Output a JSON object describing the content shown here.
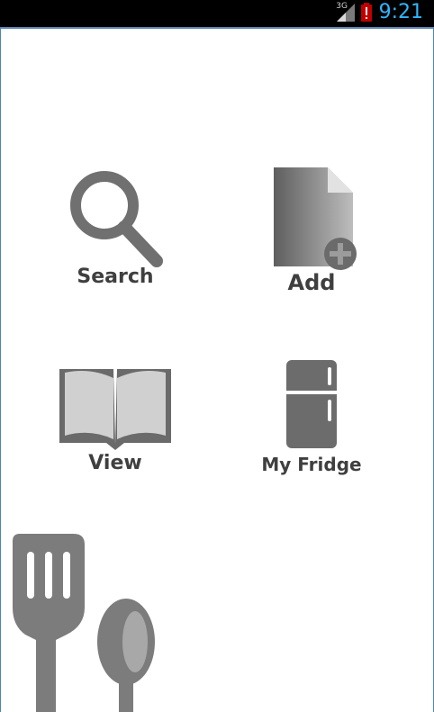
{
  "status_bar": {
    "network": "3G",
    "time": "9:21"
  },
  "menu": {
    "search_label": "Search",
    "add_label": "Add",
    "view_label": "View",
    "fridge_label": "My Fridge"
  },
  "colors": {
    "icon_gray": "#707070",
    "icon_light": "#d0d0d0",
    "clock": "#2fb6ff"
  }
}
